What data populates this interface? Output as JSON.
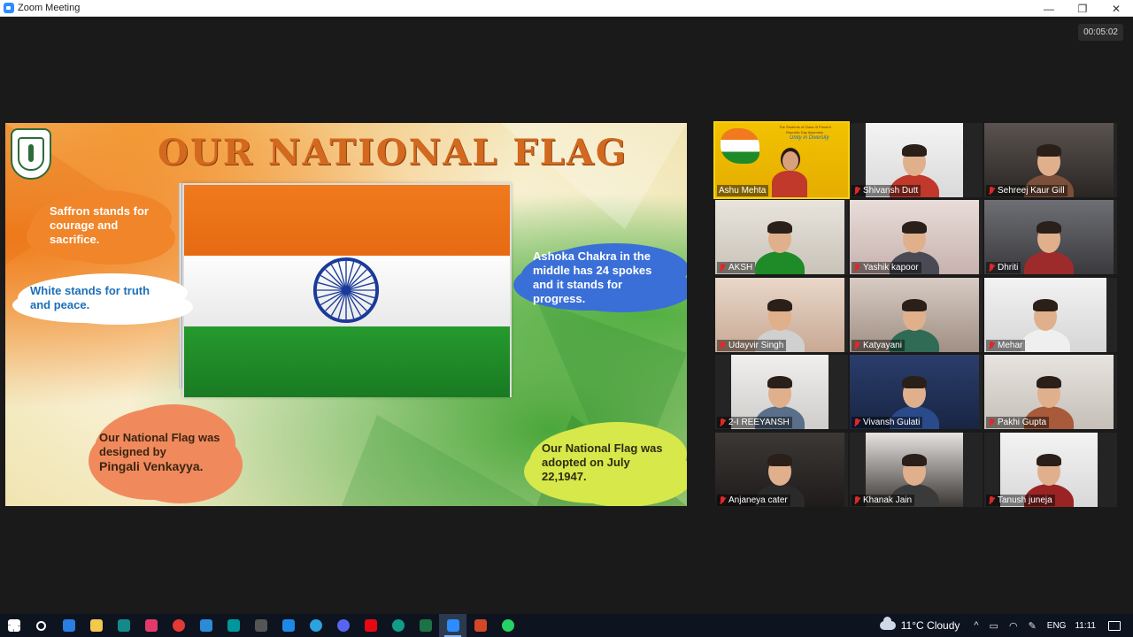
{
  "window": {
    "title": "Zoom Meeting",
    "minimize": "—",
    "restore": "❐",
    "close": "✕"
  },
  "meeting": {
    "timer": "00:05:02"
  },
  "slide": {
    "title": "OUR NATIONAL FLAG",
    "saffron_text": "Saffron stands for courage and sacrifice.",
    "white_text": "White stands for truth and peace.",
    "ashoka_text": "Ashoka Chakra in the middle has 24 spokes and it stands for progress.",
    "designer_text_1": "Our National Flag was designed by",
    "designer_text_2": "Pingali Venkayya.",
    "adopted_text": "Our National Flag was adopted on July 22,1947.",
    "colors": {
      "saffron": "#f07a1d",
      "white": "#ffffff",
      "green": "#1f8b28",
      "chakra": "#1a3a9a"
    }
  },
  "host_slide": {
    "line1": "The Students of Class III Present",
    "line2": "Republic Day Assembly",
    "line3": "Unity in Diversity"
  },
  "participants": [
    {
      "name": "Ashu Mehta",
      "muted": false
    },
    {
      "name": "Shivansh Dutt",
      "muted": true
    },
    {
      "name": "Sehreej Kaur Gill",
      "muted": true
    },
    {
      "name": "AKSH",
      "muted": true
    },
    {
      "name": "Yashik kapoor",
      "muted": true
    },
    {
      "name": "Dhriti",
      "muted": true
    },
    {
      "name": "Udayvir Singh",
      "muted": true
    },
    {
      "name": "Katyayani",
      "muted": true
    },
    {
      "name": "Mehar",
      "muted": true
    },
    {
      "name": "2-I REEYANSH",
      "muted": true
    },
    {
      "name": "Vivansh Gulati",
      "muted": true
    },
    {
      "name": "Pakhi Gupta",
      "muted": true
    },
    {
      "name": "Anjaneya cater",
      "muted": true
    },
    {
      "name": "Khanak Jain",
      "muted": true
    },
    {
      "name": "Tanush juneja",
      "muted": true
    }
  ],
  "taskbar": {
    "weather": "11°C  Cloudy",
    "language": "ENG",
    "time": "11:11",
    "apps": [
      "start",
      "search",
      "mail",
      "files",
      "sway",
      "media",
      "record",
      "vscode",
      "arduino",
      "terminal",
      "notes",
      "telegram",
      "discord",
      "netflix",
      "edge",
      "excel",
      "zoom",
      "powerpoint",
      "whatsapp"
    ]
  }
}
